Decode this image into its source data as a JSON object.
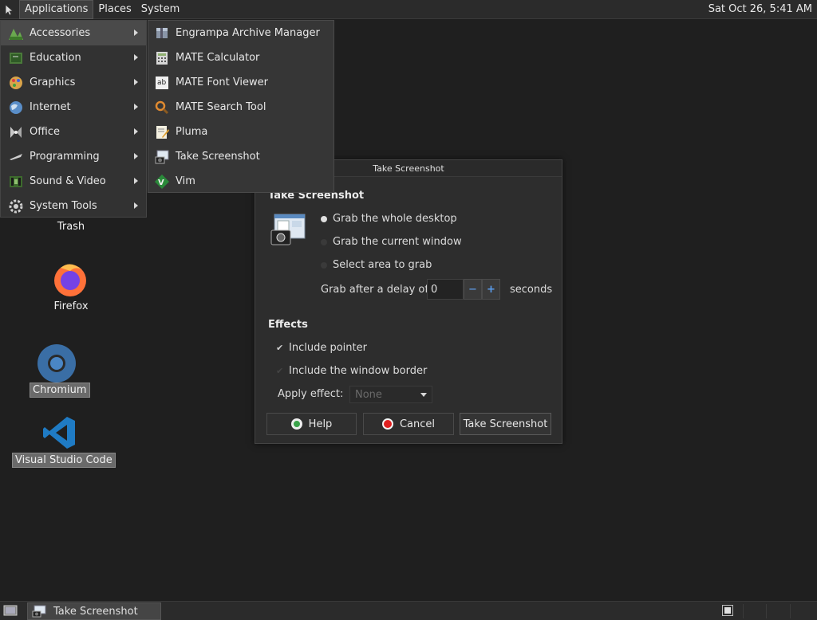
{
  "top_panel": {
    "menus": [
      "Applications",
      "Places",
      "System"
    ],
    "clock": "Sat Oct 26,  5:41 AM"
  },
  "app_menu": {
    "categories": [
      {
        "label": "Accessories",
        "icon": "accessories-icon"
      },
      {
        "label": "Education",
        "icon": "education-icon"
      },
      {
        "label": "Graphics",
        "icon": "graphics-icon"
      },
      {
        "label": "Internet",
        "icon": "internet-icon"
      },
      {
        "label": "Office",
        "icon": "office-icon"
      },
      {
        "label": "Programming",
        "icon": "programming-icon"
      },
      {
        "label": "Sound & Video",
        "icon": "sound-video-icon"
      },
      {
        "label": "System Tools",
        "icon": "system-tools-icon"
      }
    ],
    "accessories": [
      {
        "label": "Engrampa Archive Manager",
        "icon": "archive-icon"
      },
      {
        "label": "MATE Calculator",
        "icon": "calculator-icon"
      },
      {
        "label": "MATE Font Viewer",
        "icon": "font-viewer-icon"
      },
      {
        "label": "MATE Search Tool",
        "icon": "search-tool-icon"
      },
      {
        "label": "Pluma",
        "icon": "text-editor-icon"
      },
      {
        "label": "Take Screenshot",
        "icon": "screenshot-icon"
      },
      {
        "label": "Vim",
        "icon": "vim-icon"
      }
    ]
  },
  "desktop": {
    "icons": [
      "Trash",
      "Firefox",
      "Chromium",
      "Visual Studio Code"
    ]
  },
  "dialog": {
    "window_title": "Take Screenshot",
    "heading": "Take Screenshot",
    "options": [
      "Grab the whole desktop",
      "Grab the current window",
      "Select area to grab"
    ],
    "selected_option": "Grab the whole desktop",
    "delay_label": "Grab after a delay of",
    "delay_value": "0",
    "delay_unit": "seconds",
    "effects_heading": "Effects",
    "include_pointer": "Include pointer",
    "include_border": "Include the window border",
    "apply_effect_label": "Apply effect:",
    "apply_effect_value": "None",
    "help_button": "Help",
    "cancel_button": "Cancel",
    "take_button": "Take Screenshot"
  },
  "bottom_panel": {
    "task": "Take Screenshot"
  }
}
